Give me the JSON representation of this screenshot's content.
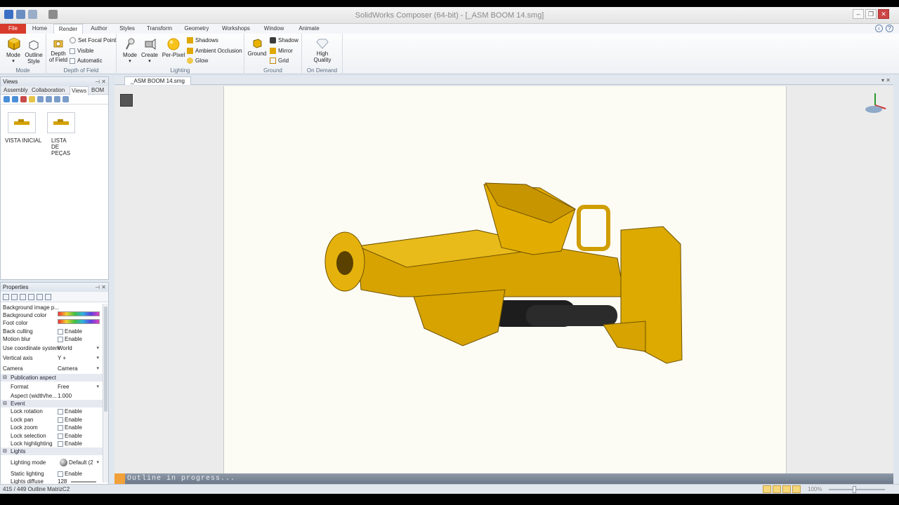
{
  "window": {
    "title": "SolidWorks Composer (64-bit) - [_ASM BOOM 14.smg]"
  },
  "tabs": [
    "File",
    "Home",
    "Render",
    "Author",
    "Styles",
    "Transform",
    "Geometry",
    "Workshops",
    "Window",
    "Animate"
  ],
  "active_tab": "Render",
  "ribbon": {
    "mode": {
      "mode_label": "Mode",
      "outline_label": "Outline Style",
      "group": "Mode"
    },
    "dof": {
      "depth_label": "Depth of Field",
      "set_focal": "Set Focal Point",
      "visible": "Visible",
      "automatic": "Automatic",
      "group": "Depth of Field"
    },
    "lighting": {
      "mode_label": "Mode",
      "create_label": "Create",
      "perpixel_label": "Per-Pixel",
      "shadows": "Shadows",
      "ambient": "Ambient Occlusion",
      "glow": "Glow",
      "group": "Lighting"
    },
    "ground": {
      "ground_label": "Ground",
      "shadow": "Shadow",
      "mirror": "Mirror",
      "grid": "Grid",
      "group": "Ground"
    },
    "ondemand": {
      "hq_label": "High Quality",
      "group": "On Demand"
    }
  },
  "views_panel": {
    "title": "Views",
    "tabs": [
      "Assembly",
      "Collaboration",
      "Views",
      "BOM"
    ],
    "thumbs": [
      {
        "label": "VISTA INICIAL"
      },
      {
        "label": "LISTA DE PEÇAS"
      }
    ]
  },
  "properties": {
    "title": "Properties",
    "rows": [
      {
        "k": "Background image p...",
        "v": ""
      },
      {
        "k": "Background color",
        "v": ""
      },
      {
        "k": "Foot color",
        "v": ""
      },
      {
        "k": "Back culling",
        "v": "Enable"
      },
      {
        "k": "Motion blur",
        "v": "Enable"
      },
      {
        "k": "Use coordinate system",
        "v": "World"
      },
      {
        "k": "Vertical axis",
        "v": "Y +"
      },
      {
        "k": "Camera",
        "v": "Camera"
      },
      {
        "k": "Publication aspect",
        "v": ""
      },
      {
        "k": "Format",
        "v": "Free"
      },
      {
        "k": "Aspect (width/he...",
        "v": "1.000"
      },
      {
        "k": "Event",
        "v": ""
      },
      {
        "k": "Lock rotation",
        "v": "Enable"
      },
      {
        "k": "Lock pan",
        "v": "Enable"
      },
      {
        "k": "Lock zoom",
        "v": "Enable"
      },
      {
        "k": "Lock selection",
        "v": "Enable"
      },
      {
        "k": "Lock highlighting",
        "v": "Enable"
      },
      {
        "k": "Lights",
        "v": ""
      },
      {
        "k": "Lighting mode",
        "v": "Default (2"
      },
      {
        "k": "Static lighting",
        "v": "Enable"
      },
      {
        "k": "Lights diffuse",
        "v": "128"
      }
    ]
  },
  "document": {
    "tab": "_ASM BOOM 14.smg"
  },
  "outline_status": "Outline in progress...",
  "statusbar": {
    "text": "415 / 449 Outline MatrizC2",
    "zoom": "100%"
  }
}
